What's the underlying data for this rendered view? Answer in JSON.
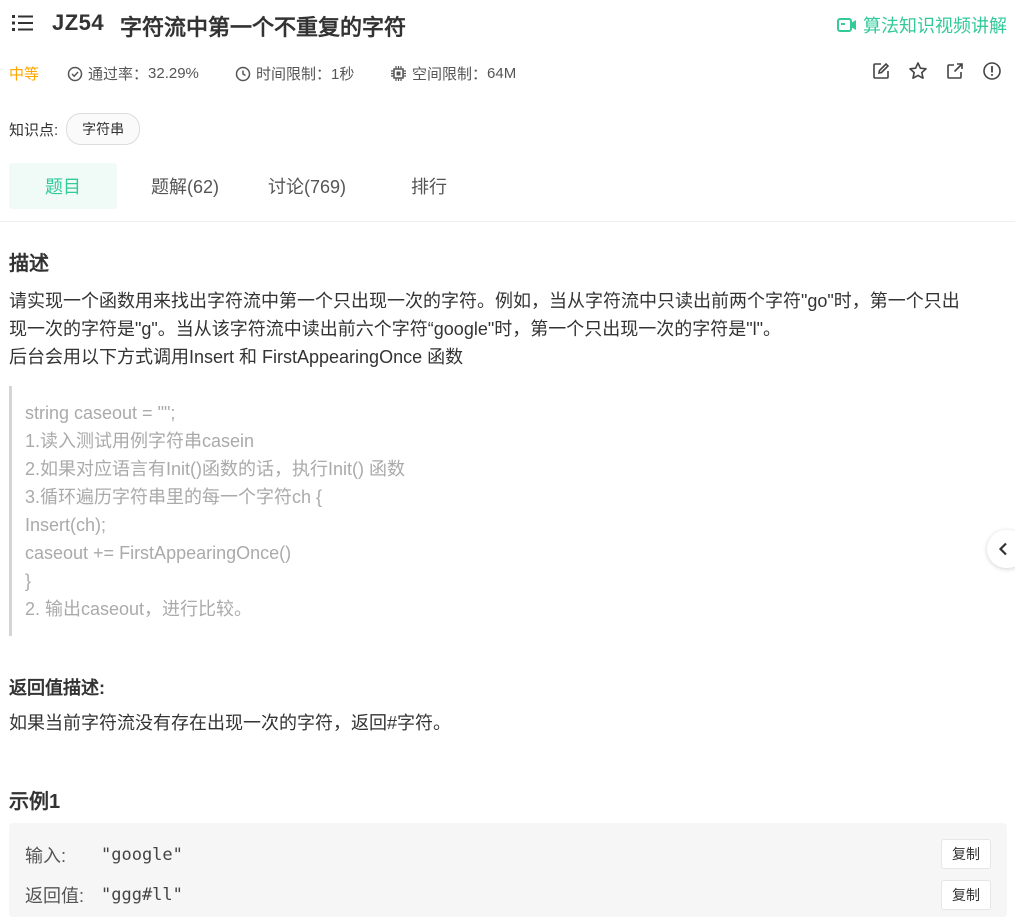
{
  "problem": {
    "code": "JZ54",
    "title": "字符流中第一个不重复的字符",
    "video_link": "算法知识视频讲解"
  },
  "meta": {
    "difficulty": "中等",
    "pass_rate_label": "通过率：",
    "pass_rate_value": "32.29%",
    "time_limit_label": "时间限制：",
    "time_limit_value": "1秒",
    "space_limit_label": "空间限制：",
    "space_limit_value": "64M"
  },
  "tools": [
    "edit-icon",
    "star-icon",
    "share-icon",
    "report-icon"
  ],
  "knowledge": {
    "label": "知识点:",
    "tags": [
      "字符串"
    ]
  },
  "tabs": [
    {
      "label": "题目",
      "active": true
    },
    {
      "label": "题解(62)",
      "active": false
    },
    {
      "label": "讨论(769)",
      "active": false
    },
    {
      "label": "排行",
      "active": false
    }
  ],
  "description": {
    "heading": "描述",
    "line1": "请实现一个函数用来找出字符流中第一个只出现一次的字符。例如，当从字符流中只读出前两个字符\"go\"时，第一个只出",
    "line2": "现一次的字符是\"g\"。当从该字符流中读出前六个字符“google\"时，第一个只出现一次的字符是\"l\"。",
    "line3": "后台会用以下方式调用Insert 和 FirstAppearingOnce 函数",
    "code_lines": [
      "string caseout = \"\";",
      "1.读入测试用例字符串casein",
      "2.如果对应语言有Init()函数的话，执行Init() 函数",
      "3.循环遍历字符串里的每一个字符ch {",
      "Insert(ch);",
      "caseout += FirstAppearingOnce()",
      "}",
      "2. 输出caseout，进行比较。"
    ]
  },
  "return_desc": {
    "heading": "返回值描述:",
    "text": "如果当前字符流没有存在出现一次的字符，返回#字符。"
  },
  "example": {
    "heading": "示例1",
    "input_label": "输入:",
    "input_value": "\"google\"",
    "output_label": "返回值:",
    "output_value": "\"ggg#ll\"",
    "copy_label": "复制"
  },
  "colors": {
    "accent": "#32ca99",
    "difficulty": "#ffa500"
  }
}
